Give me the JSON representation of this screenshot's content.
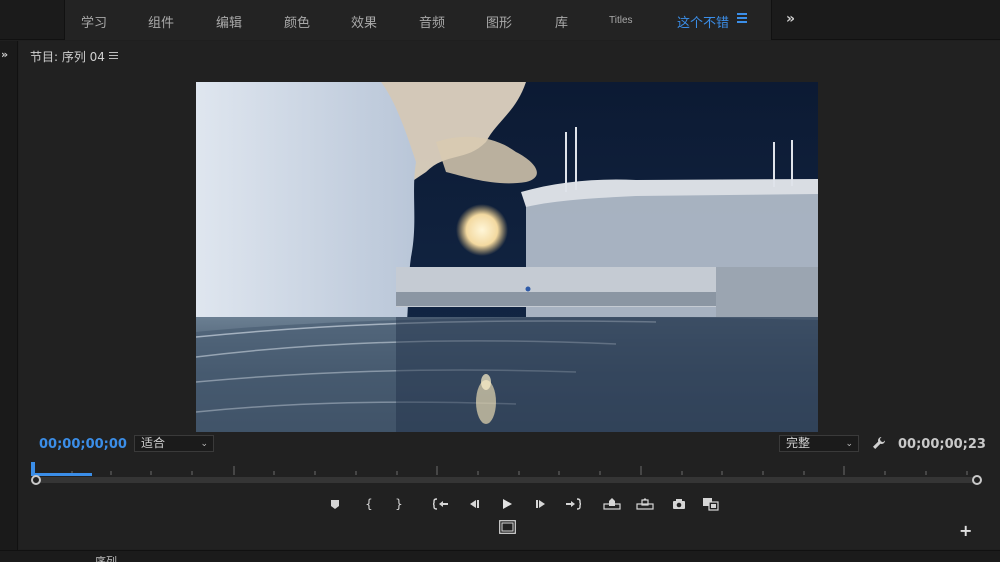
{
  "workspace_tabs": [
    {
      "label": "学习",
      "active": false
    },
    {
      "label": "组件",
      "active": false
    },
    {
      "label": "编辑",
      "active": false
    },
    {
      "label": "颜色",
      "active": false
    },
    {
      "label": "效果",
      "active": false
    },
    {
      "label": "音频",
      "active": false
    },
    {
      "label": "图形",
      "active": false
    },
    {
      "label": "库",
      "active": false
    },
    {
      "label": "Titles",
      "active": false
    },
    {
      "label": "这个不错",
      "active": true
    }
  ],
  "program_monitor": {
    "title": "节目: 序列 04",
    "current_timecode": "00;00;00;00",
    "duration_timecode": "00;00;00;23",
    "fit_select": {
      "value": "适合"
    },
    "quality_select": {
      "value": "完整"
    },
    "playhead_progress": 0.065
  },
  "bottom_panel": {
    "tab_label": "序列"
  },
  "icons": {
    "overflow": "double-chevron-right-icon",
    "panel_menu": "hamburger-menu-icon",
    "settings": "wrench-icon",
    "add": "plus-icon"
  },
  "transport_controls": [
    "add-marker-icon",
    "mark-in-icon",
    "mark-out-icon",
    "go-to-in-icon",
    "step-back-icon",
    "play-icon",
    "step-forward-icon",
    "go-to-out-icon",
    "lift-icon",
    "extract-icon",
    "export-frame-icon",
    "comparison-view-icon"
  ],
  "colors": {
    "accent": "#3b8ee8",
    "panel_bg": "#212121",
    "text": "#bdbdbd"
  }
}
